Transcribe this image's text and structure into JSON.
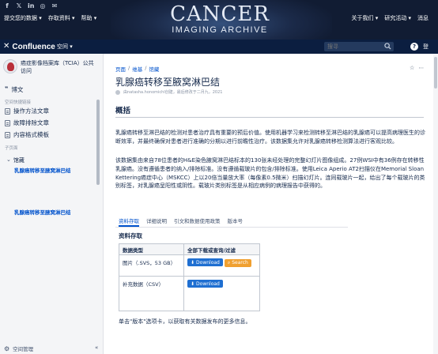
{
  "banner": {
    "social_icons": [
      {
        "icon": "facebook-icon",
        "glyph": "f"
      },
      {
        "icon": "twitter-icon",
        "glyph": "𝕏"
      },
      {
        "icon": "linkedin-icon",
        "glyph": "in"
      },
      {
        "icon": "instagram-icon",
        "glyph": "◎"
      },
      {
        "icon": "email-icon",
        "glyph": "✉"
      }
    ],
    "nav_left": [
      "提交您的数据 ▾",
      "存取资料 ▾",
      "帮助 ▾"
    ],
    "nav_right": [
      "关于我们 ▾",
      "研究活动 ▾",
      "消息"
    ],
    "logo_title": "CANCER",
    "logo_subtitle": "IMAGING ARCHIVE"
  },
  "confluence_header": {
    "brand": "Confluence",
    "spaces_label": "空间 ▾",
    "search_placeholder": "搜寻",
    "help_label": "?",
    "login_label": "登"
  },
  "sidebar": {
    "space_name": "癌症影像档案库（TCIA）公共访问",
    "blog_label": "博文",
    "shortcuts_heading": "空间快捷链接",
    "shortcuts": [
      "操作方法文章",
      "故障排除文章",
      "内容格式模板"
    ],
    "pages_heading": "子页面",
    "tree_parent": "馆藏",
    "tree_current": "乳腺癌转移至腋窝淋巴结",
    "tree_duplicate": "乳腺癌转移至腋窝淋巴结",
    "footer_label": "空间管理",
    "collapse_label": "«"
  },
  "main": {
    "breadcrumb": [
      "页面",
      "维基",
      "馆藏"
    ],
    "title": "乳腺癌转移至腋窝淋巴结",
    "byline": "由natasha.honomichl创建，最后修改于二月九，2021",
    "page_tools": [
      "☆",
      "⋯"
    ],
    "overview_heading": "概括",
    "paragraph_1": "乳腺癌转移至淋巴结的检测对患者治疗具有重要的预后价值。使用机器学习来检测转移至淋巴结的乳腺癌可以提高病理医生的诊断效率，并最终确保对患者进行准确的分期以进行前瞻性治疗。该数据集允许对乳腺癌转移检测算法进行客观比较。",
    "paragraph_2": "该数据集由来自78位患者的H&E染色腋窝淋巴结标本的130张未经处理的完整幻灯片图像组成。27例WSI中有36例存在转移性乳腺癌。没有遵循患者的纳入/排除标准。没有遵循载玻片的包含/排除标准。使用Leica Aperio AT2扫描仪在Memorial Sloan Kettering癌症中心（MSKCC）上以20倍当量放大率（每像素0.5微米）扫描幻灯片。连同载玻片一起，给出了每个载玻片的类别标签，对乳腺癌呈阳性或阴性。载玻片类别标签是从相应病例的病理报告中获得的。",
    "tabs": [
      "资料存取",
      "详细说明",
      "引文和数据使用政策",
      "版本号"
    ],
    "active_tab": 0,
    "access_heading": "资料存取",
    "table": {
      "headers": [
        "数据类型",
        "全部下载或查询/过滤"
      ],
      "rows": [
        {
          "type": "图片（.SVS，53 GB）",
          "buttons": [
            {
              "label": "Download",
              "icon": "download-icon",
              "color": "#1f6fd1"
            },
            {
              "label": "Search",
              "icon": "search-icon",
              "color": "#f0a030"
            }
          ]
        },
        {
          "type": "补充数据（CSV）",
          "buttons": [
            {
              "label": "Download",
              "icon": "download-icon",
              "color": "#1f6fd1"
            }
          ]
        }
      ]
    },
    "footer_note": "单击\"版本\"选项卡，以获取有关数据发布的更多信息。"
  }
}
